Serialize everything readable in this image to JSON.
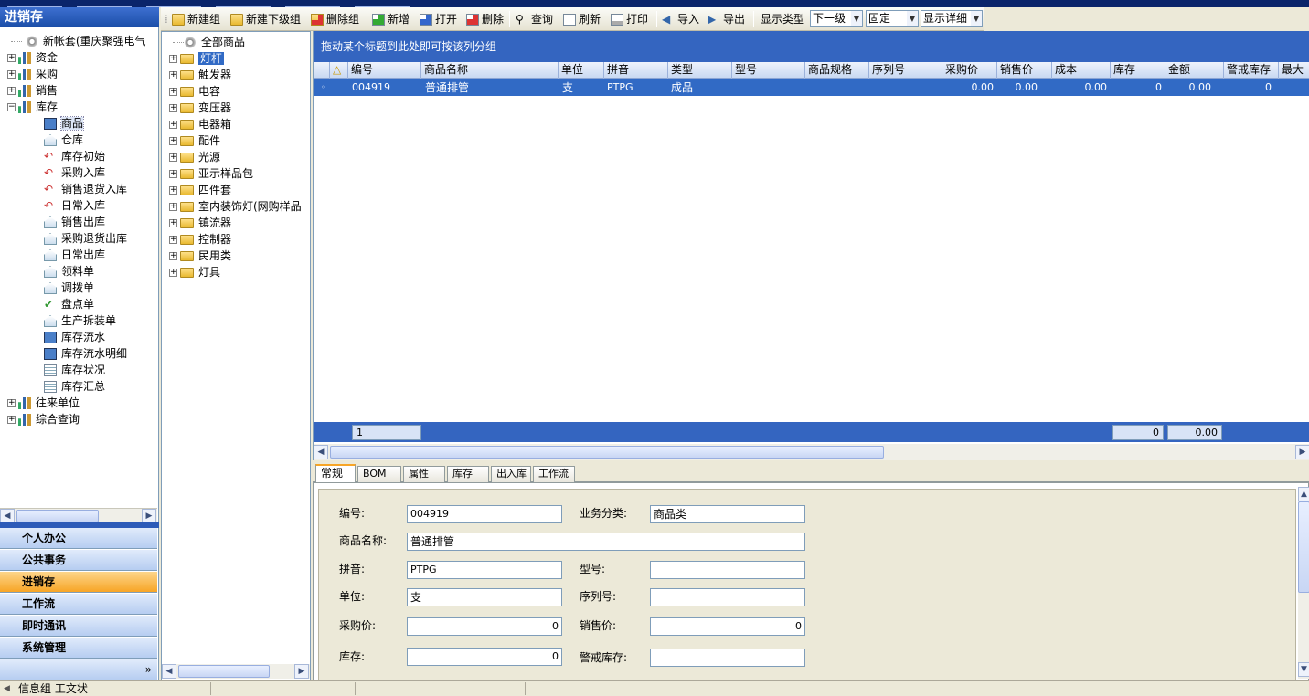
{
  "left_panel": {
    "title": "进销存",
    "tree": {
      "root_label": "新帐套(重庆聚强电气",
      "items": [
        {
          "label": "资金"
        },
        {
          "label": "采购"
        },
        {
          "label": "销售"
        },
        {
          "label": "库存",
          "children": [
            {
              "label": "商品",
              "icon": "cube-icon"
            },
            {
              "label": "仓库",
              "icon": "warehouse-icon"
            },
            {
              "label": "库存初始",
              "icon": "arrow-icon"
            },
            {
              "label": "采购入库",
              "icon": "arrow-icon"
            },
            {
              "label": "销售退货入库",
              "icon": "arrow-icon"
            },
            {
              "label": "日常入库",
              "icon": "arrow-icon"
            },
            {
              "label": "销售出库",
              "icon": "warehouse-icon"
            },
            {
              "label": "采购退货出库",
              "icon": "warehouse-icon"
            },
            {
              "label": "日常出库",
              "icon": "warehouse-icon"
            },
            {
              "label": "领料单",
              "icon": "warehouse-icon"
            },
            {
              "label": "调拨单",
              "icon": "warehouse-icon"
            },
            {
              "label": "盘点单",
              "icon": "check-icon"
            },
            {
              "label": "生产拆装单",
              "icon": "warehouse-icon"
            },
            {
              "label": "库存流水",
              "icon": "cube-icon"
            },
            {
              "label": "库存流水明细",
              "icon": "cube-icon"
            },
            {
              "label": "库存状况",
              "icon": "document-icon"
            },
            {
              "label": "库存汇总",
              "icon": "document-icon"
            }
          ]
        },
        {
          "label": "往来单位"
        },
        {
          "label": "综合查询"
        }
      ]
    },
    "nav_buttons": [
      "个人办公",
      "公共事务",
      "进销存",
      "工作流",
      "即时通讯",
      "系统管理"
    ],
    "active_nav": "进销存",
    "more_glyph": "»"
  },
  "toolbar": {
    "new_group": "新建组",
    "new_subgroup": "新建下级组",
    "delete_group": "删除组",
    "add": "新增",
    "open": "打开",
    "delete": "删除",
    "query": "查询",
    "refresh": "刷新",
    "print": "打印",
    "import": "导入",
    "export": "导出",
    "display_type_label": "显示类型",
    "display_type_value": "下一级",
    "fixed_value": "固定",
    "detail_value": "显示详细"
  },
  "category_tree": {
    "root": "全部商品",
    "items": [
      "灯杆",
      "触发器",
      "电容",
      "变压器",
      "电器箱",
      "配件",
      "光源",
      "亚示样品包",
      "四件套",
      "室内装饰灯(网购样品",
      "镇流器",
      "控制器",
      "民用类",
      "灯具"
    ],
    "selected": "灯杆"
  },
  "grid": {
    "group_hint": "拖动某个标题到此处即可按该列分组",
    "columns": [
      "编号",
      "商品名称",
      "单位",
      "拼音",
      "类型",
      "型号",
      "商品规格",
      "序列号",
      "采购价",
      "销售价",
      "成本",
      "库存",
      "金额",
      "警戒库存",
      "最大"
    ],
    "rows": [
      {
        "code": "004919",
        "name": "普通排管",
        "unit": "支",
        "pinyin": "PTPG",
        "type": "成品",
        "model": "",
        "spec": "",
        "serial": "",
        "purchase_price": "0.00",
        "sale_price": "0.00",
        "cost": "0.00",
        "stock": "0",
        "amount": "0.00",
        "alert_stock": "0"
      }
    ],
    "footer_count": "1",
    "footer_stock_total": "0",
    "footer_amount_total": "0.00"
  },
  "tabs": [
    "常规",
    "BOM",
    "属性",
    "库存",
    "出入库",
    "工作流"
  ],
  "active_tab": "常规",
  "form": {
    "code_label": "编号:",
    "code_value": "004919",
    "category_label": "业务分类:",
    "category_value": "商品类",
    "name_label": "商品名称:",
    "name_value": "普通排管",
    "pinyin_label": "拼音:",
    "pinyin_value": "PTPG",
    "model_label": "型号:",
    "model_value": "",
    "unit_label": "单位:",
    "unit_value": "支",
    "serial_label": "序列号:",
    "serial_value": "",
    "purchase_label": "采购价:",
    "purchase_value": "0",
    "sale_label": "销售价:",
    "sale_value": "0",
    "stock_label": "库存:",
    "stock_value": "0",
    "alert_label": "警戒库存:",
    "alert_value": ""
  },
  "status_bar": {
    "text": "信息组 工文状"
  }
}
